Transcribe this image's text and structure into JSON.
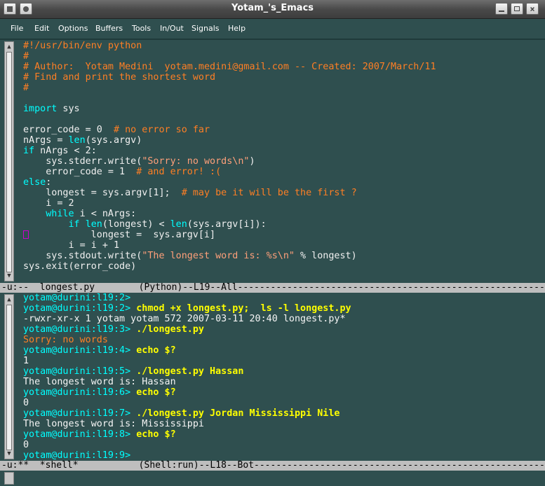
{
  "window": {
    "title": "Yotam_'s_Emacs"
  },
  "menu": [
    "File",
    "Edit",
    "Options",
    "Buffers",
    "Tools",
    "In/Out",
    "Signals",
    "Help"
  ],
  "editor_lines": [
    [
      [
        "#!/usr/bin/env python",
        "cm"
      ]
    ],
    [
      [
        "#",
        "cm"
      ]
    ],
    [
      [
        "# Author:  Yotam Medini  yotam.medini@gmail.com -- Created: 2007/March/11",
        "cm"
      ]
    ],
    [
      [
        "# Find and print the shortest word",
        "cm"
      ]
    ],
    [
      [
        "#",
        "cm"
      ]
    ],
    [],
    [
      [
        "import",
        "kw"
      ],
      [
        " sys",
        ""
      ]
    ],
    [],
    [
      [
        "error_code = 0  ",
        ""
      ],
      [
        "# no error so far",
        "cm"
      ]
    ],
    [
      [
        "nArgs = ",
        ""
      ],
      [
        "len",
        "kw"
      ],
      [
        "(sys.argv)",
        ""
      ]
    ],
    [
      [
        "if",
        "kw"
      ],
      [
        " nArgs < 2:",
        ""
      ]
    ],
    [
      [
        "    sys.stderr.write(",
        ""
      ],
      [
        "\"Sorry: no words\\n\"",
        "st"
      ],
      [
        ")",
        ""
      ]
    ],
    [
      [
        "    error_code = 1  ",
        ""
      ],
      [
        "# and error! :(",
        "cm"
      ]
    ],
    [
      [
        "else",
        "kw"
      ],
      [
        ":",
        ""
      ]
    ],
    [
      [
        "    longest = sys.argv[1];  ",
        ""
      ],
      [
        "# may be it will be the first ?",
        "cm"
      ]
    ],
    [
      [
        "    i = 2",
        ""
      ]
    ],
    [
      [
        "    ",
        ""
      ],
      [
        "while",
        "kw"
      ],
      [
        " i < nArgs:",
        ""
      ]
    ],
    [
      [
        "        ",
        ""
      ],
      [
        "if",
        "kw"
      ],
      [
        " ",
        ""
      ],
      [
        "len",
        "kw"
      ],
      [
        "(longest) < ",
        ""
      ],
      [
        "len",
        "kw"
      ],
      [
        "(sys.argv[i]):",
        ""
      ]
    ],
    [
      [
        "CURSOR",
        ""
      ],
      [
        "           longest =  sys.argv[i]",
        ""
      ]
    ],
    [
      [
        "        i = i + 1",
        ""
      ]
    ],
    [
      [
        "    sys.stdout.write(",
        ""
      ],
      [
        "\"The longest word is: %s\\n\"",
        "st"
      ],
      [
        " % longest)",
        ""
      ]
    ],
    [
      [
        "sys.exit(error_code)",
        ""
      ]
    ]
  ],
  "modeline_top": "-u:--  longest.py        (Python)--L19--All--------------------------------------------------------------",
  "shell_lines": [
    [
      [
        "yotam@durini:l19:2>",
        "pr"
      ]
    ],
    [
      [
        "yotam@durini:l19:2>",
        "pr"
      ],
      [
        " chmod +x longest.py;  ls -l longest.py",
        "bk"
      ]
    ],
    [
      [
        "-rwxr-xr-x 1 yotam yotam 572 2007-03-11 20:40 longest.py*",
        "wh"
      ]
    ],
    [
      [
        "yotam@durini:l19:3>",
        "pr"
      ],
      [
        " ./longest.py",
        "bk"
      ]
    ],
    [
      [
        "Sorry: no words",
        "cm"
      ]
    ],
    [
      [
        "yotam@durini:l19:4>",
        "pr"
      ],
      [
        " echo $?",
        "bk"
      ]
    ],
    [
      [
        "1",
        "wh"
      ]
    ],
    [
      [
        "yotam@durini:l19:5>",
        "pr"
      ],
      [
        " ./longest.py Hassan",
        "bk"
      ]
    ],
    [
      [
        "The longest word is: Hassan",
        "wh"
      ]
    ],
    [
      [
        "yotam@durini:l19:6>",
        "pr"
      ],
      [
        " echo $?",
        "bk"
      ]
    ],
    [
      [
        "0",
        "wh"
      ]
    ],
    [
      [
        "yotam@durini:l19:7>",
        "pr"
      ],
      [
        " ./longest.py Jordan Mississippi Nile",
        "bk"
      ]
    ],
    [
      [
        "The longest word is: Mississippi",
        "wh"
      ]
    ],
    [
      [
        "yotam@durini:l19:8>",
        "pr"
      ],
      [
        " echo $?",
        "bk"
      ]
    ],
    [
      [
        "0",
        "wh"
      ]
    ],
    [
      [
        "yotam@durini:l19:9>",
        "pr"
      ]
    ]
  ],
  "modeline_bottom": "-u:**  *shell*           (Shell:run)--L18--Bot--------------------------------------------------------------",
  "colors": {
    "bg": "#2f4f4f",
    "comment": "#ff7f24",
    "keyword": "#00ffff",
    "string": "#ffa07a",
    "modeline": "#bebebe"
  }
}
